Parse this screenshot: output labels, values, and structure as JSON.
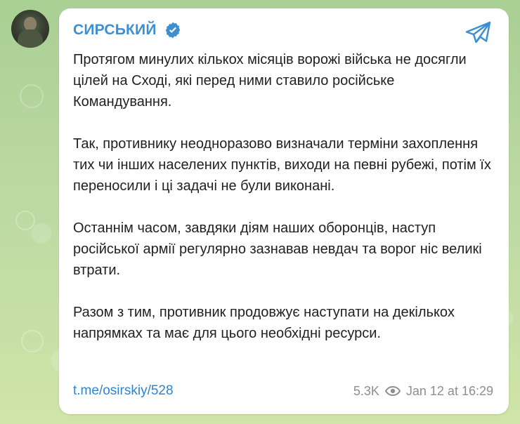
{
  "post": {
    "channel_name": "СИРСЬКИЙ",
    "paragraphs": [
      "Протягом минулих кількох місяців ворожі війська не досягли цілей на Сході, які перед ними ставило російське Командування.",
      "Так, противнику неодноразово визначали терміни захоплення тих чи інших населених пунктів, виходи на певні рубежі, потім їх переносили і ці задачі не були виконані.",
      "Останнім часом, завдяки діям наших оборонців, наступ російської армії регулярно зазнавав невдач та ворог ніс великі втрати.",
      "Разом з тим, противник продовжує наступати на декількох напрямках та має для цього необхідні ресурси."
    ],
    "link": "t.me/osirskiy/528",
    "views": "5.3K",
    "timestamp": "Jan 12 at 16:29"
  },
  "icons": {
    "verified": "verified-badge-icon",
    "share": "telegram-share-icon",
    "views": "eye-icon"
  },
  "colors": {
    "accent": "#3c8fd3",
    "link": "#2f84cb",
    "meta": "#8e8e8e",
    "background": "#b7d5a0"
  }
}
